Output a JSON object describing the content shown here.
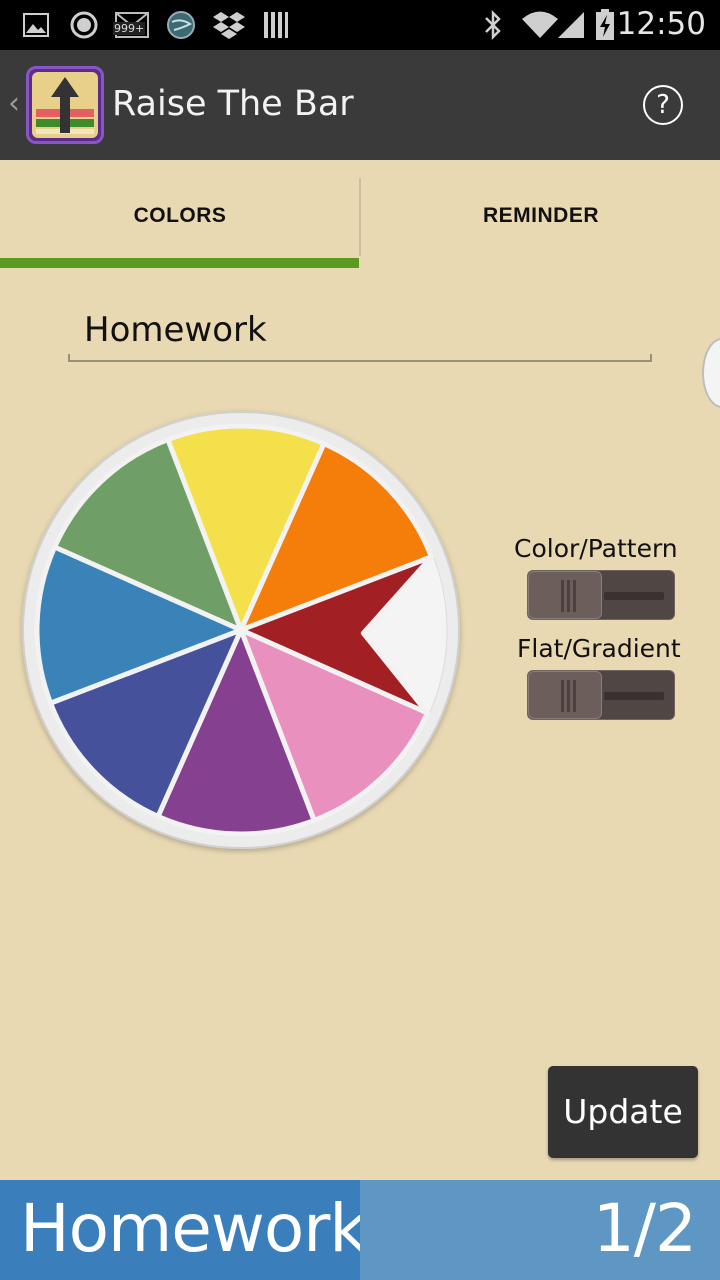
{
  "status_bar": {
    "time": "12:50",
    "icons": [
      "gallery-icon",
      "circle-icon",
      "mail-icon",
      "globe-icon",
      "dropbox-icon",
      "barcode-icon",
      "bluetooth-icon",
      "wifi-icon",
      "signal-icon",
      "battery-charging-icon"
    ],
    "mail_badge": "999+"
  },
  "action_bar": {
    "title": "Raise The Bar",
    "back_glyph": "‹",
    "help_glyph": "?"
  },
  "tabs": [
    {
      "label": "COLORS",
      "selected": true
    },
    {
      "label": "REMINDER",
      "selected": false
    }
  ],
  "name_field": {
    "value": "Homework"
  },
  "toggles": {
    "color_pattern_label": "Color/Pattern",
    "flat_gradient_label": "Flat/Gradient"
  },
  "wheel": {
    "colors": [
      "#f4e04a",
      "#f57d0a",
      "#a21f24",
      "#e990bf",
      "#85418f",
      "#45519a",
      "#3a83b9",
      "#6f9e67"
    ],
    "selected_color": "#a21f24"
  },
  "update_button": {
    "label": "Update"
  },
  "bottom_bar": {
    "name": "Homework",
    "page": "1/2",
    "left_color": "#3a7ebc",
    "right_color": "#5f97c4"
  }
}
